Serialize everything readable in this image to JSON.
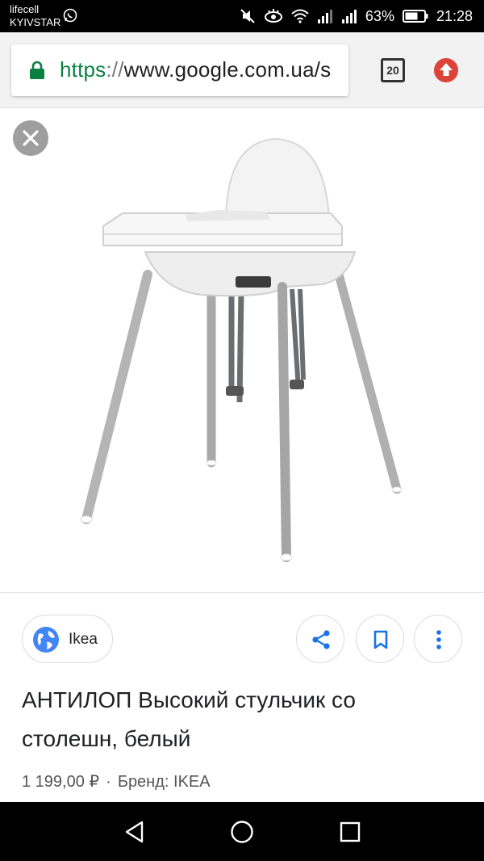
{
  "status_bar": {
    "carrier_1": "lifecell",
    "carrier_2": "KYIVSTAR",
    "battery": "63%",
    "time": "21:28"
  },
  "browser": {
    "url_scheme": "https",
    "url_separator": "://",
    "url_host": "www.google.com.ua/s",
    "tab_count": "20",
    "accent_color": "#0b8043",
    "update_color": "#db4437"
  },
  "image_viewer": {
    "close_icon": "close-icon",
    "image_subject": "high-chair-with-tray"
  },
  "result": {
    "source_label": "Ikea",
    "title": "АНТИЛОП Высокий стульчик со столешн, белый",
    "price": "1 199,00 ₽",
    "separator": "·",
    "brand": "Бренд: IKEA"
  },
  "actions": {
    "share_icon": "share-icon",
    "save_icon": "bookmark-icon",
    "more_icon": "more-vert-icon"
  },
  "nav": {
    "back_icon": "back-icon",
    "home_icon": "home-icon",
    "recents_icon": "recents-icon"
  }
}
